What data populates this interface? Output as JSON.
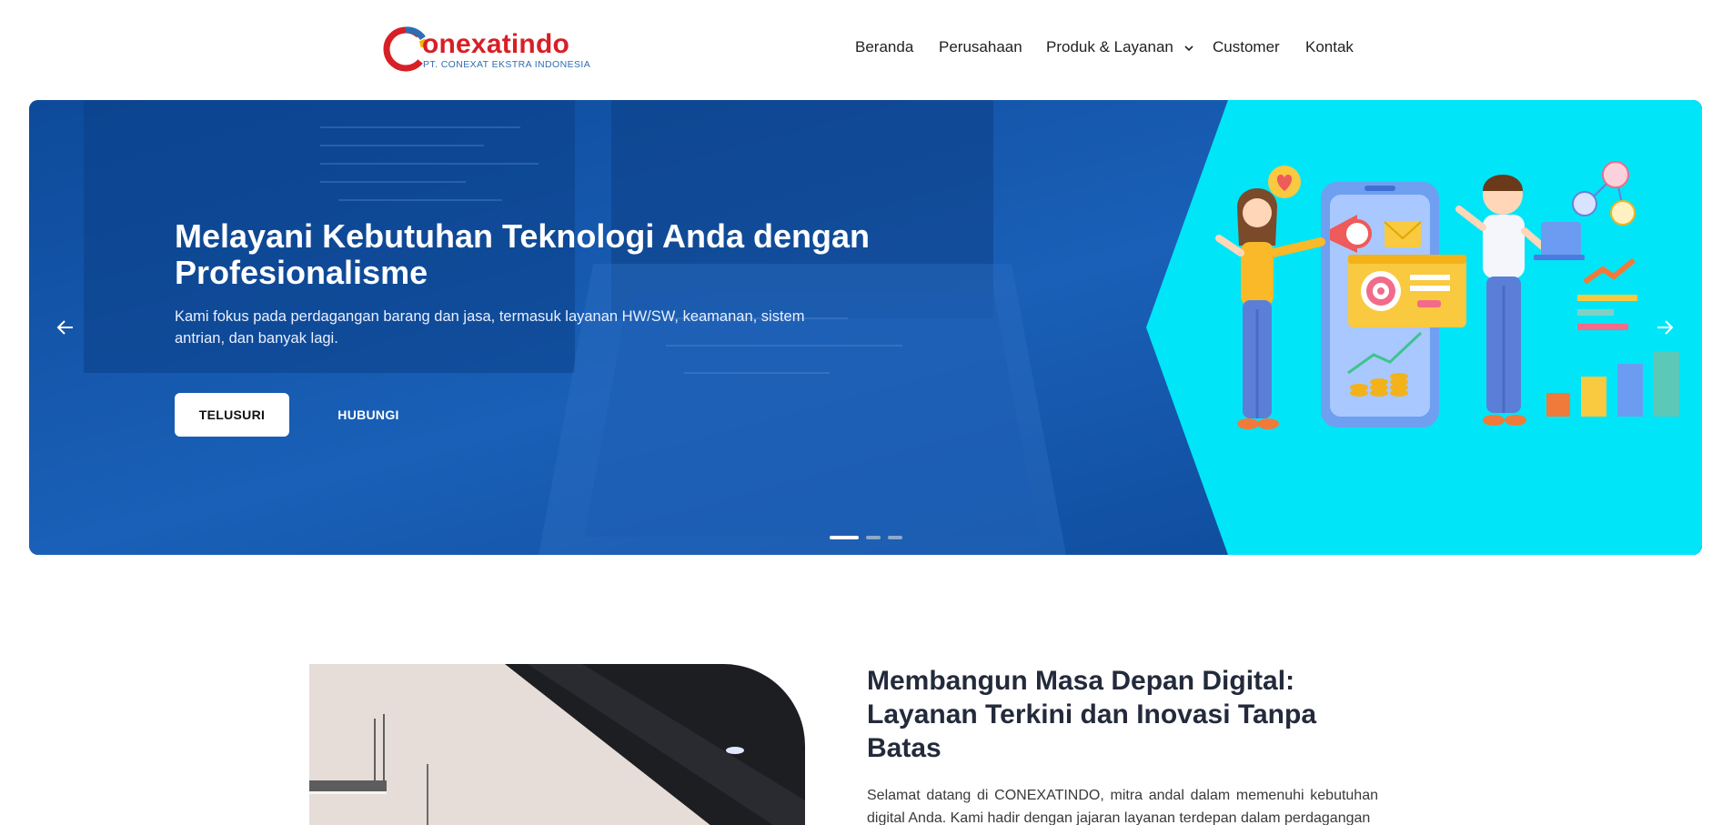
{
  "brand": {
    "name": "onexatindo",
    "tagline": "PT. CONEXAT EKSTRA INDONESIA",
    "red": "#d71f26",
    "blue": "#2f6db3"
  },
  "nav": {
    "items": [
      {
        "label": "Beranda"
      },
      {
        "label": "Perusahaan"
      },
      {
        "label": "Produk & Layanan",
        "has_dropdown": true
      },
      {
        "label": "Customer"
      },
      {
        "label": "Kontak"
      }
    ]
  },
  "hero": {
    "title": "Melayani Kebutuhan Teknologi Anda dengan Profesionalisme",
    "description": "Kami fokus pada perdagangan barang dan jasa, termasuk layanan HW/SW, keamanan, sistem antrian, dan banyak lagi.",
    "primary_button": "TELUSURI",
    "secondary_button": "HUBUNGI",
    "slide_count": 3,
    "active_slide": 1,
    "bg_color": "#0a4ea3",
    "accent_color": "#00e5f7",
    "prev_icon": "arrow-left-icon",
    "next_icon": "arrow-right-icon"
  },
  "about": {
    "title": "Membangun Masa Depan Digital: Layanan Terkini dan Inovasi Tanpa Batas",
    "text": "Selamat datang di CONEXATINDO, mitra andal dalam memenuhi kebutuhan digital Anda. Kami hadir dengan jajaran layanan terdepan dalam perdagangan"
  }
}
